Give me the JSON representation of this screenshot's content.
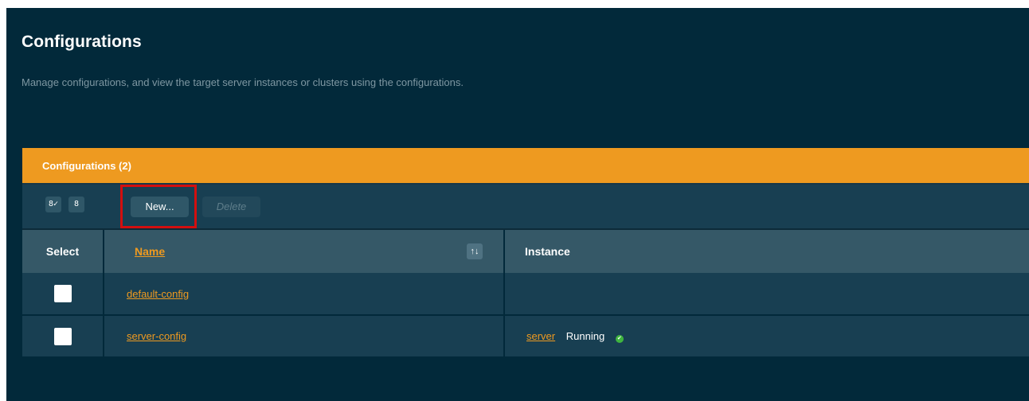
{
  "page": {
    "title": "Configurations",
    "description": "Manage configurations, and view the target server instances or clusters using the configurations."
  },
  "table": {
    "caption": "Configurations (2)",
    "toolbar": {
      "select_all_glyph": "8✓",
      "deselect_all_glyph": "8",
      "new_label": "New...",
      "delete_label": "Delete"
    },
    "columns": {
      "select": "Select",
      "name": "Name",
      "sort_glyph": "↑↓",
      "instance": "Instance"
    },
    "rows": [
      {
        "name": "default-config",
        "instance": "",
        "status": ""
      },
      {
        "name": "server-config",
        "instance": "server",
        "status": "Running"
      }
    ]
  },
  "icons": {
    "status_ok": "check-circle-icon"
  },
  "colors": {
    "background": "#02293a",
    "accent": "#ee9a20",
    "header": "#355867",
    "row": "#183f52",
    "highlight": "#d20f0f",
    "status_ok": "#3fb53f"
  }
}
